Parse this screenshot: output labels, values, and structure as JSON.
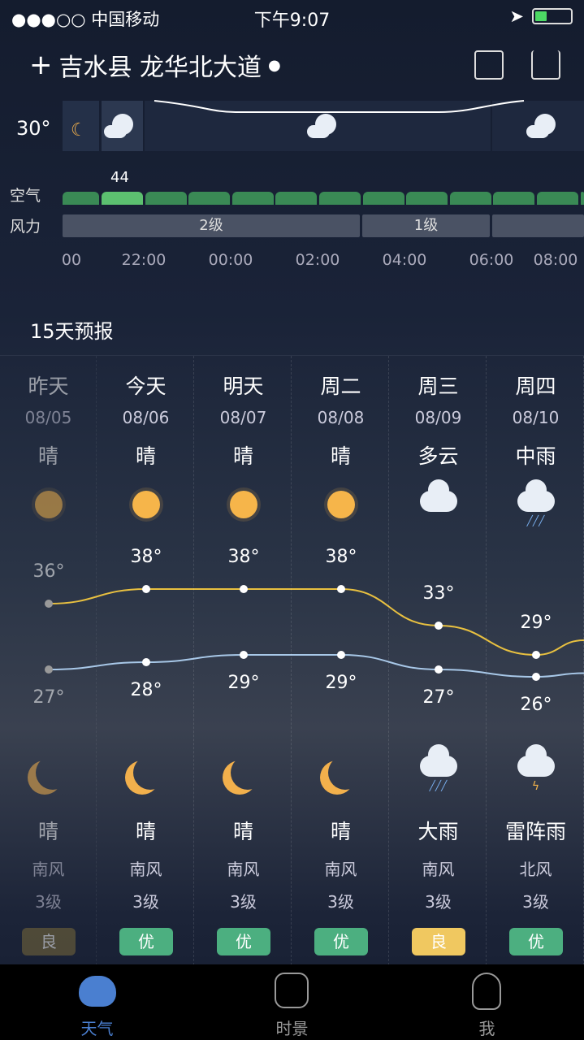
{
  "status": {
    "carrier": "●●●○○ 中国移动",
    "time": "下午9:07"
  },
  "header": {
    "add": "+",
    "location": "吉水县 龙华北大道",
    "pin": "📍"
  },
  "hourly": {
    "current_temp": "30°",
    "air_label": "空气",
    "wind_label": "风力",
    "aqi_value": "44",
    "wind": [
      {
        "label": "2级"
      },
      {
        "label": "1级"
      },
      {
        "label": ""
      }
    ],
    "times": [
      "00",
      "22:00",
      "00:00",
      "02:00",
      "04:00",
      "06:00",
      "08:00"
    ]
  },
  "forecast": {
    "title": "15天预报",
    "days": [
      {
        "name": "昨天",
        "date": "08/05",
        "day_cond": "晴",
        "day_icon": "sun",
        "high": 36,
        "high_label": "36°",
        "low": 27,
        "low_label": "27°",
        "night_icon": "moon",
        "night_cond": "晴",
        "wind_dir": "南风",
        "wind_lvl": "3级",
        "aqi": "良",
        "aqi_color": "#7a6a3a",
        "past": true
      },
      {
        "name": "今天",
        "date": "08/06",
        "day_cond": "晴",
        "day_icon": "sun",
        "high": 38,
        "high_label": "38°",
        "low": 28,
        "low_label": "28°",
        "night_icon": "moon",
        "night_cond": "晴",
        "wind_dir": "南风",
        "wind_lvl": "3级",
        "aqi": "优",
        "aqi_color": "#4caf80"
      },
      {
        "name": "明天",
        "date": "08/07",
        "day_cond": "晴",
        "day_icon": "sun",
        "high": 38,
        "high_label": "38°",
        "low": 29,
        "low_label": "29°",
        "night_icon": "moon",
        "night_cond": "晴",
        "wind_dir": "南风",
        "wind_lvl": "3级",
        "aqi": "优",
        "aqi_color": "#4caf80"
      },
      {
        "name": "周二",
        "date": "08/08",
        "day_cond": "晴",
        "day_icon": "sun",
        "high": 38,
        "high_label": "38°",
        "low": 29,
        "low_label": "29°",
        "night_icon": "moon",
        "night_cond": "晴",
        "wind_dir": "南风",
        "wind_lvl": "3级",
        "aqi": "优",
        "aqi_color": "#4caf80"
      },
      {
        "name": "周三",
        "date": "08/09",
        "day_cond": "多云",
        "day_icon": "partly-cloudy",
        "high": 33,
        "high_label": "33°",
        "low": 27,
        "low_label": "27°",
        "night_icon": "heavy-rain",
        "night_cond": "大雨",
        "wind_dir": "南风",
        "wind_lvl": "3级",
        "aqi": "良",
        "aqi_color": "#f0c860"
      },
      {
        "name": "周四",
        "date": "08/10",
        "day_cond": "中雨",
        "day_icon": "rain",
        "high": 29,
        "high_label": "29°",
        "low": 26,
        "low_label": "26°",
        "night_icon": "thunderstorm",
        "night_cond": "雷阵雨",
        "wind_dir": "北风",
        "wind_lvl": "3级",
        "aqi": "优",
        "aqi_color": "#4caf80"
      }
    ]
  },
  "tabs": [
    {
      "label": "天气",
      "active": true
    },
    {
      "label": "时景"
    },
    {
      "label": "我"
    }
  ],
  "colors": {
    "high_line": "#e8c040",
    "low_line": "#a8c8e8",
    "tab_active": "#4a7fd0"
  }
}
